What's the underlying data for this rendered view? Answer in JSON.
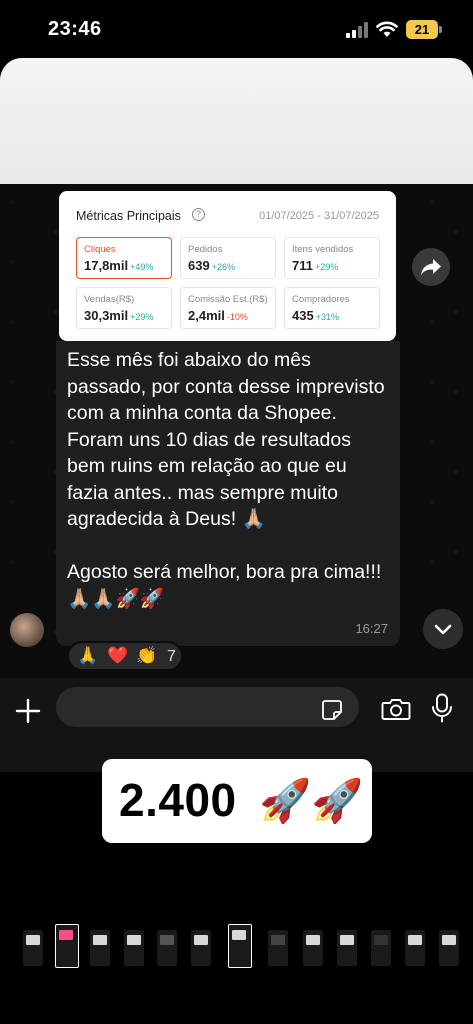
{
  "status_bar": {
    "time": "23:46",
    "battery": "21"
  },
  "metrics": {
    "title": "Métricas Principais",
    "date_range": "01/07/2025 - 31/07/2025",
    "cells": [
      {
        "label": "Cliques",
        "value": "17,8mil",
        "change": "+49%"
      },
      {
        "label": "Pedidos",
        "value": "639",
        "change": "+26%"
      },
      {
        "label": "Itens vendidos",
        "value": "711",
        "change": "+29%"
      },
      {
        "label": "Vendas(R$)",
        "value": "30,3mil",
        "change": "+29%"
      },
      {
        "label": "Comissão Est.(R$)",
        "value": "2,4mil",
        "change": "-10%"
      },
      {
        "label": "Compradores",
        "value": "435",
        "change": "+31%"
      }
    ]
  },
  "message": {
    "text": "Esse mês foi abaixo do mês passado, por conta desse imprevisto com a minha conta da Shopee. Foram uns 10 dias de resultados bem ruins em relação ao que eu fazia antes.. mas sempre muito agradecida à Deus! 🙏🏼\n\nAgosto será melhor, bora pra cima!!! 🙏🏼🙏🏼🚀🚀",
    "time": "16:27"
  },
  "reactions": {
    "emojis": [
      "🙏",
      "❤️",
      "👏"
    ],
    "count": "7"
  },
  "sticker": {
    "text": "2.400",
    "emoji": "🚀🚀"
  },
  "icons": {
    "forward": "forward-arrow-icon",
    "scroll_down": "chevron-down-icon",
    "plus": "plus-icon",
    "sticker": "sticker-icon",
    "camera": "camera-icon",
    "mic": "microphone-icon"
  }
}
